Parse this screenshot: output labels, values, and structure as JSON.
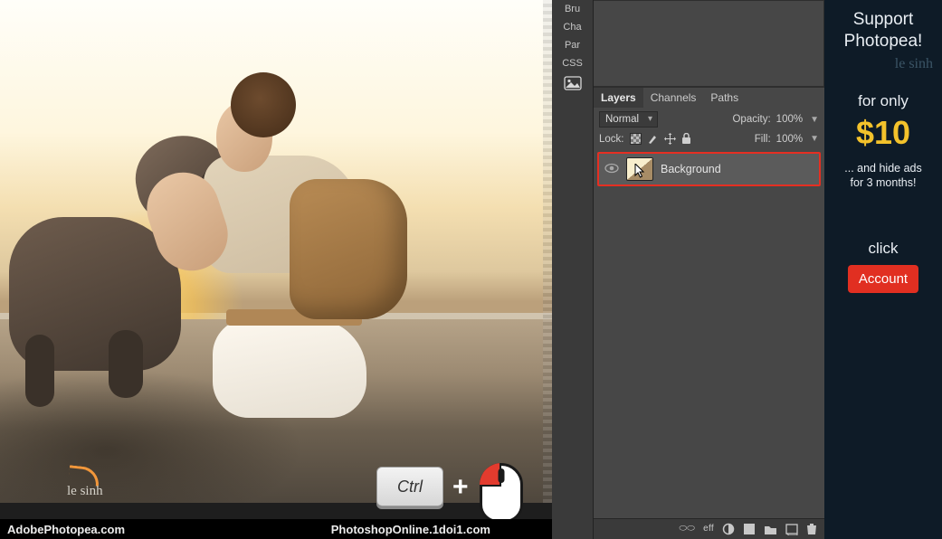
{
  "panel_tabs": {
    "bru": "Bru",
    "cha": "Cha",
    "par": "Par",
    "css": "CSS"
  },
  "layers": {
    "tabs": {
      "layers": "Layers",
      "channels": "Channels",
      "paths": "Paths"
    },
    "blend_mode": "Normal",
    "opacity_label": "Opacity:",
    "opacity_value": "100%",
    "lock_label": "Lock:",
    "fill_label": "Fill:",
    "fill_value": "100%",
    "items": [
      {
        "name": "Background",
        "visible": true
      }
    ],
    "toolbar": {
      "link": "link",
      "fx": "eff",
      "mask": "mask",
      "adjust": "adjust",
      "group": "group",
      "new": "new",
      "delete": "delete"
    }
  },
  "key_hint": {
    "key": "Ctrl",
    "plus": "+"
  },
  "footer": {
    "left": "AdobePhotopea.com",
    "right": "PhotoshopOnline.1doi1.com"
  },
  "watermark": "le sinh",
  "ad": {
    "title_line1": "Support",
    "title_line2": "Photopea!",
    "logo": "le sinh",
    "for_only": "for only",
    "price": "$10",
    "sub_line1": "... and hide ads",
    "sub_line2": "for 3 months!",
    "click": "click",
    "account": "Account"
  }
}
